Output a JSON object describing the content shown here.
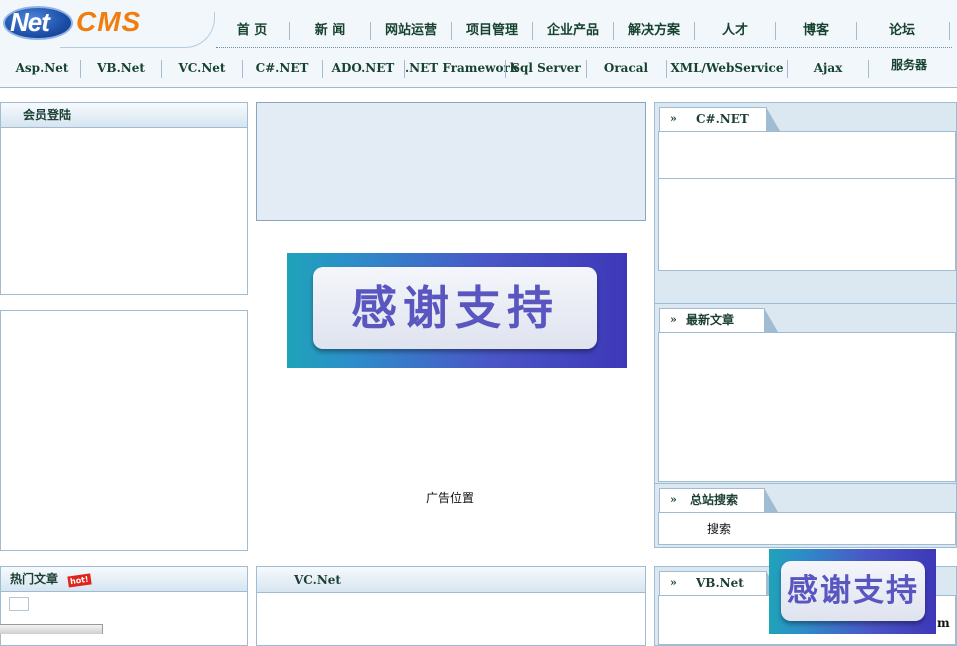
{
  "logo": {
    "part1": "Net",
    "part2": "CMS"
  },
  "nav_top": [
    "首 页",
    "新 闻",
    "网站运营",
    "项目管理",
    "企业产品",
    "解决方案",
    "人才",
    "博客",
    "论坛"
  ],
  "nav_sub": [
    "Asp.Net",
    "VB.Net",
    "VC.Net",
    "C#.NET",
    "ADO.NET",
    ".NET Framework",
    "Sql Server",
    "Oracal",
    "XML/WebService",
    "Ajax",
    "服务器"
  ],
  "left": {
    "login_title": "会员登陆",
    "hot_title": "热门文章",
    "hot_badge": "hot!"
  },
  "center": {
    "banner_text": "感谢支持",
    "ad_text": "广告位置",
    "vcnet_title": "VC.Net"
  },
  "right": {
    "arrow": "»",
    "csharp_title": "C#.NET",
    "latest_title": "最新文章",
    "search_title": "总站搜索",
    "search_button": "搜索",
    "vbnet_title": "VB.Net",
    "float_banner_text": "感谢支持",
    "float_suffix": "m"
  }
}
